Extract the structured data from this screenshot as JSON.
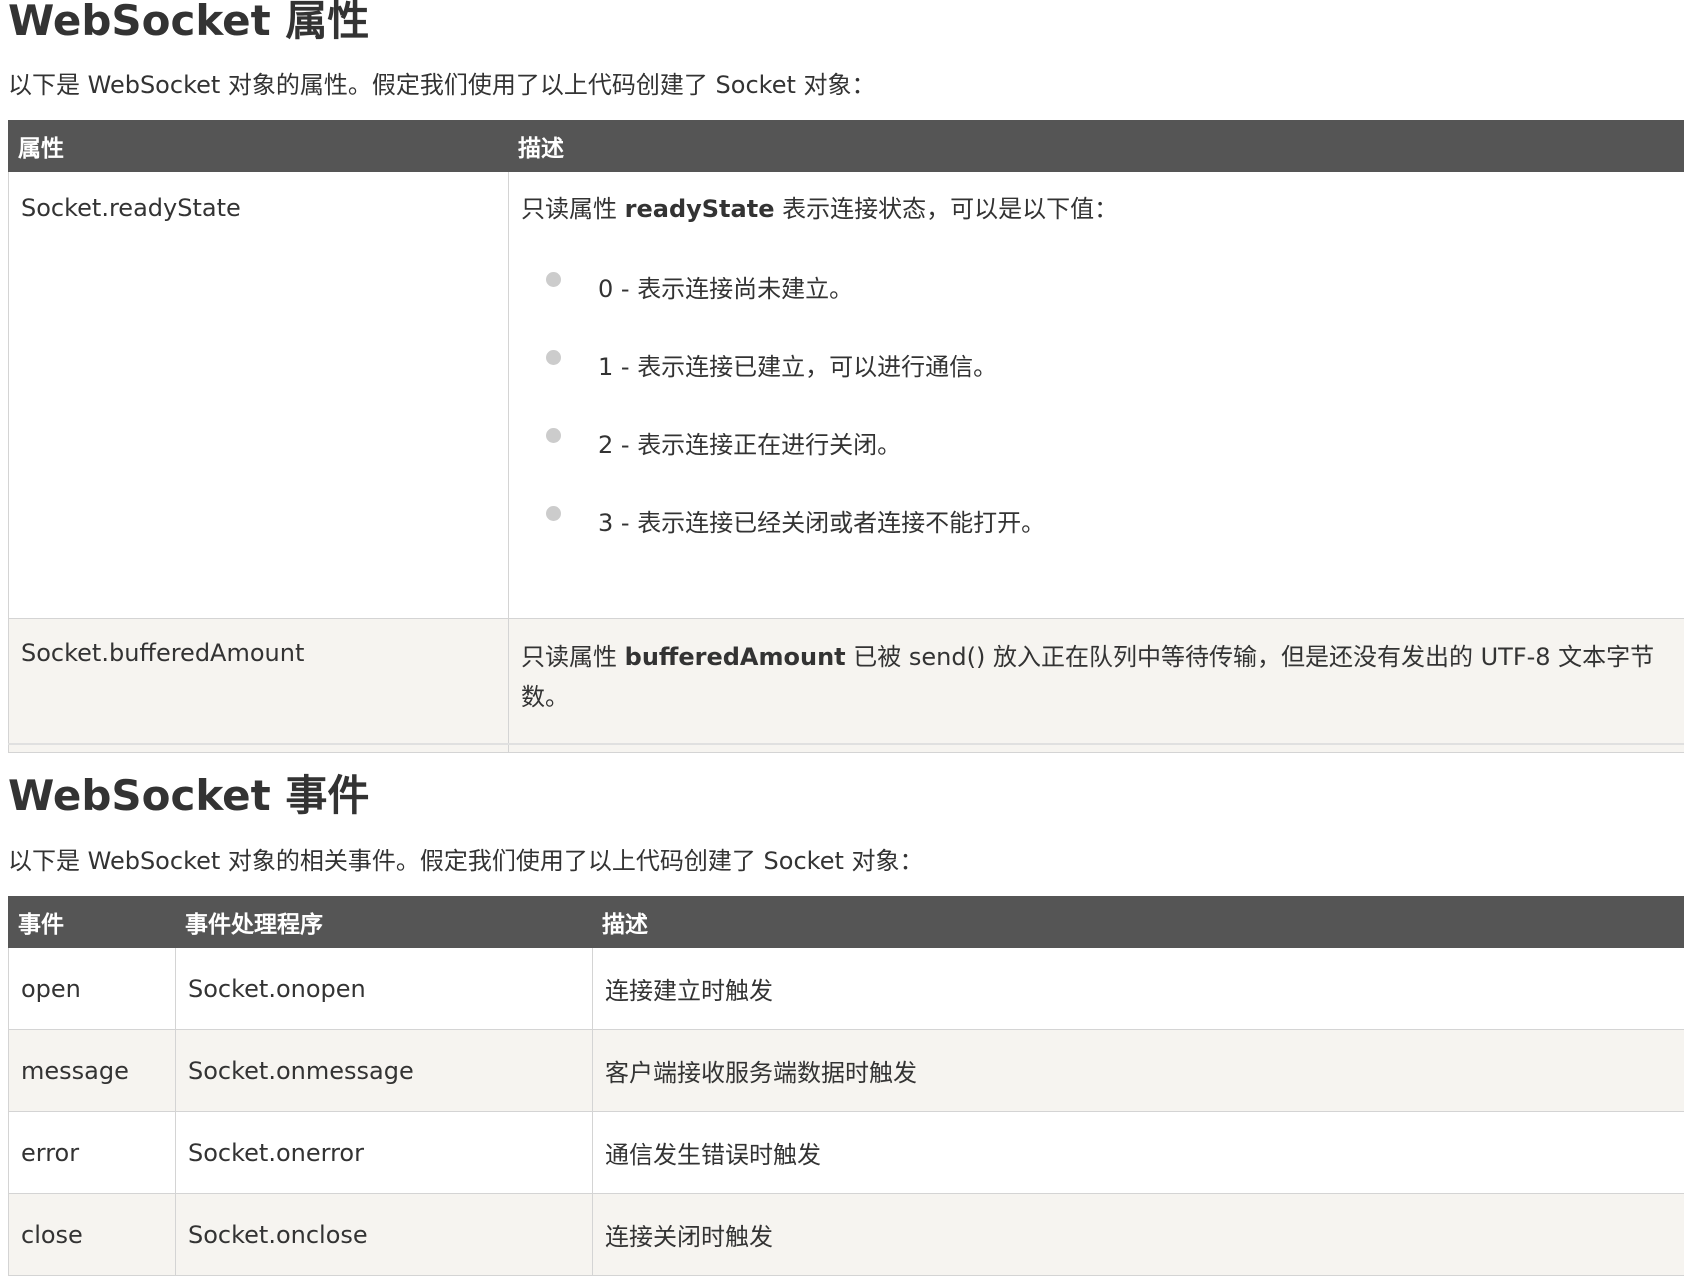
{
  "properties_section": {
    "heading": "WebSocket 属性",
    "intro": "以下是 WebSocket 对象的属性。假定我们使用了以上代码创建了 Socket 对象：",
    "columns": [
      "属性",
      "描述"
    ],
    "rows": [
      {
        "name": "Socket.readyState",
        "desc_prefix": "只读属性 ",
        "desc_bold": "readyState",
        "desc_suffix": " 表示连接状态，可以是以下值：",
        "states": [
          "0 - 表示连接尚未建立。",
          "1 - 表示连接已建立，可以进行通信。",
          "2 - 表示连接正在进行关闭。",
          "3 - 表示连接已经关闭或者连接不能打开。"
        ]
      },
      {
        "name": "Socket.bufferedAmount",
        "desc_prefix": "只读属性 ",
        "desc_bold": "bufferedAmount",
        "desc_suffix": " 已被 send() 放入正在队列中等待传输，但是还没有发出的 UTF-8 文本字节数。"
      }
    ]
  },
  "events_section": {
    "heading": "WebSocket 事件",
    "intro": "以下是 WebSocket 对象的相关事件。假定我们使用了以上代码创建了 Socket 对象：",
    "columns": [
      "事件",
      "事件处理程序",
      "描述"
    ],
    "rows": [
      {
        "event": "open",
        "handler": "Socket.onopen",
        "desc": "连接建立时触发"
      },
      {
        "event": "message",
        "handler": "Socket.onmessage",
        "desc": "客户端接收服务端数据时触发"
      },
      {
        "event": "error",
        "handler": "Socket.onerror",
        "desc": "通信发生错误时触发"
      },
      {
        "event": "close",
        "handler": "Socket.onclose",
        "desc": "连接关闭时触发"
      }
    ]
  },
  "colors": {
    "header_bg": "#555555",
    "header_text": "#ffffff",
    "row_alt_bg": "#f6f4f0",
    "border": "#d4d4d4",
    "bullet": "#cccccc"
  },
  "icons": [
    "bullet-icon"
  ]
}
